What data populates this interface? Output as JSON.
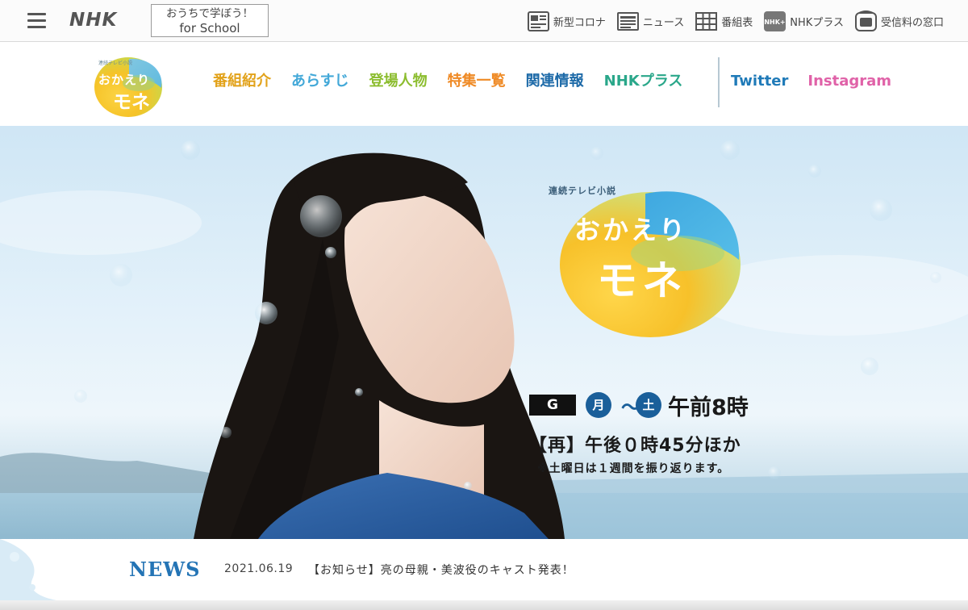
{
  "topbar": {
    "menu_icon": "hamburger-menu-icon",
    "logo_text": "NHK",
    "school": {
      "line1": "おうちで学ぼう！",
      "line2": "for School"
    },
    "links": [
      {
        "label": "新型コロナ",
        "icon": "corona-info-icon"
      },
      {
        "label": "ニュース",
        "icon": "news-icon"
      },
      {
        "label": "番組表",
        "icon": "program-table-icon"
      },
      {
        "label": "NHKプラス",
        "icon": "nhk-plus-icon"
      },
      {
        "label": "受信料の窓口",
        "icon": "reception-fee-icon"
      }
    ]
  },
  "program": {
    "logo": {
      "small": "連続テレビ小説",
      "title_line1": "おかえり",
      "title_line2": "モネ"
    },
    "nav": [
      {
        "label": "番組紹介",
        "color": "#e2a21a"
      },
      {
        "label": "あらすじ",
        "color": "#42a8d8"
      },
      {
        "label": "登場人物",
        "color": "#8cbd2f"
      },
      {
        "label": "特集一覧",
        "color": "#ef8a25"
      },
      {
        "label": "関連情報",
        "color": "#1d6aa8"
      },
      {
        "label": "NHKプラス",
        "color": "#2aa78a"
      }
    ],
    "social": [
      {
        "label": "Twitter",
        "color": "#1f7ab8"
      },
      {
        "label": "Instagram",
        "color": "#e062a8"
      }
    ]
  },
  "hero": {
    "small_label": "連続テレビ小説",
    "title_line1": "おかえり",
    "title_line2": "モネ",
    "channel": "G",
    "day_from": "月",
    "day_sep": "〜",
    "day_to": "土",
    "time": "午前8時",
    "rerun": "【再】午後０時45分ほか",
    "note": "※土曜日は１週間を振り返ります。"
  },
  "news": {
    "label": "NEWS",
    "date": "2021.06.19",
    "text": "【お知らせ】亮の母親・美波役のキャスト発表！"
  },
  "colors": {
    "news_label": "#2474b5",
    "day_circle": "#1a5f9a"
  }
}
